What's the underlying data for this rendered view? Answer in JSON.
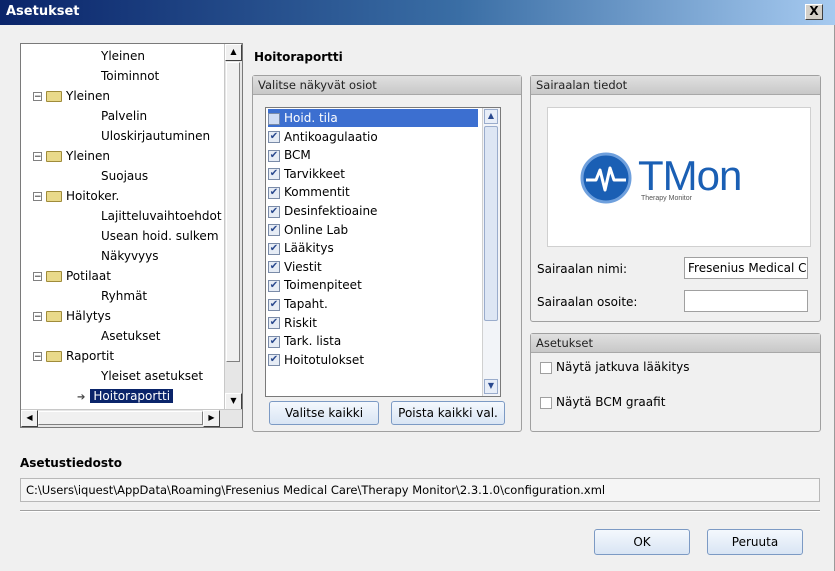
{
  "window": {
    "title": "Asetukset",
    "close_glyph": "X"
  },
  "tree": {
    "items": [
      {
        "label": "Yleinen",
        "level": 2
      },
      {
        "label": "Toiminnot",
        "level": 2
      },
      {
        "label": "Yleinen",
        "level": 1,
        "expander": "⊟"
      },
      {
        "label": "Palvelin",
        "level": 2
      },
      {
        "label": "Uloskirjautuminen",
        "level": 2
      },
      {
        "label": "Yleinen",
        "level": 1,
        "expander": "⊟"
      },
      {
        "label": "Suojaus",
        "level": 2
      },
      {
        "label": "Hoitoker.",
        "level": 1,
        "expander": "⊟"
      },
      {
        "label": "Lajitteluvaihtoehdot",
        "level": 2
      },
      {
        "label": "Usean hoid. sulkem",
        "level": 2
      },
      {
        "label": "Näkyvyys",
        "level": 2
      },
      {
        "label": "Potilaat",
        "level": 1,
        "expander": "⊟"
      },
      {
        "label": "Ryhmät",
        "level": 2
      },
      {
        "label": "Hälytys",
        "level": 1,
        "expander": "⊟"
      },
      {
        "label": "Asetukset",
        "level": 2
      },
      {
        "label": "Raportit",
        "level": 1,
        "expander": "⊟"
      },
      {
        "label": "Yleiset asetukset",
        "level": 2
      },
      {
        "label": "Hoitoraportti",
        "level": 2,
        "selected": true
      }
    ]
  },
  "main": {
    "heading": "Hoitoraportti",
    "sections_group": {
      "title": "Valitse näkyvät osiot",
      "items": [
        {
          "label": "Hoid. tila",
          "checked": false,
          "selected": true
        },
        {
          "label": "Antikoagulaatio",
          "checked": true
        },
        {
          "label": "BCM",
          "checked": true
        },
        {
          "label": "Tarvikkeet",
          "checked": true
        },
        {
          "label": "Kommentit",
          "checked": true
        },
        {
          "label": "Desinfektioaine",
          "checked": true
        },
        {
          "label": "Online Lab",
          "checked": true
        },
        {
          "label": "Lääkitys",
          "checked": true
        },
        {
          "label": "Viestit",
          "checked": true
        },
        {
          "label": "Toimenpiteet",
          "checked": true
        },
        {
          "label": "Tapaht.",
          "checked": true
        },
        {
          "label": "Riskit",
          "checked": true
        },
        {
          "label": "Tark. lista",
          "checked": true
        },
        {
          "label": "Hoitotulokset",
          "checked": true
        }
      ],
      "select_all_label": "Valitse kaikki",
      "clear_all_label": "Poista kaikki val."
    },
    "hospital_group": {
      "title": "Sairaalan tiedot",
      "logo_brand": "TMon",
      "logo_tagline": "Therapy Monitor",
      "name_label": "Sairaalan nimi:",
      "name_value": "Fresenius Medical C",
      "address_label": "Sairaalan osoite:",
      "address_value": ""
    },
    "settings_group": {
      "title": "Asetukset",
      "option1": "Näytä jatkuva lääkitys",
      "option2": "Näytä BCM graafit"
    }
  },
  "config": {
    "heading": "Asetustiedosto",
    "path": "C:\\Users\\iquest\\AppData\\Roaming\\Fresenius Medical Care\\Therapy Monitor\\2.3.1.0\\configuration.xml"
  },
  "footer": {
    "ok_label": "OK",
    "cancel_label": "Peruuta"
  },
  "colors": {
    "accent": "#3c6fd0",
    "brand_blue": "#1a5fb4"
  }
}
